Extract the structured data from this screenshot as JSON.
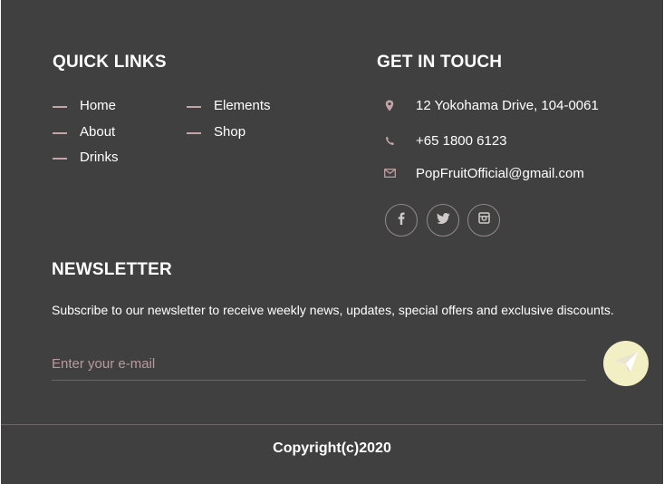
{
  "quick_links": {
    "title": "QUICK LINKS",
    "column1": [
      "Home",
      "About",
      "Drinks"
    ],
    "column2": [
      "Elements",
      "Shop"
    ]
  },
  "get_in_touch": {
    "title": "GET IN TOUCH",
    "address": "12 Yokohama Drive, 104-0061",
    "phone": "+65 1800 6123",
    "email": "PopFruitOfficial@gmail.com",
    "social_icons": [
      "facebook-icon",
      "twitter-icon",
      "instagram-icon"
    ]
  },
  "newsletter": {
    "title": "NEWSLETTER",
    "description": "Subscribe to our newsletter to receive weekly news, updates, special offers and exclusive discounts.",
    "email_placeholder": "Enter your e-mail",
    "email_value": "",
    "send_icon": "paper-plane-icon"
  },
  "copyright": "Copyright(c)2020",
  "colors": {
    "background": "#414040",
    "dash_accent": "#c4a4a6",
    "send_button": "#f2efc4",
    "placeholder": "#b89a9e"
  }
}
